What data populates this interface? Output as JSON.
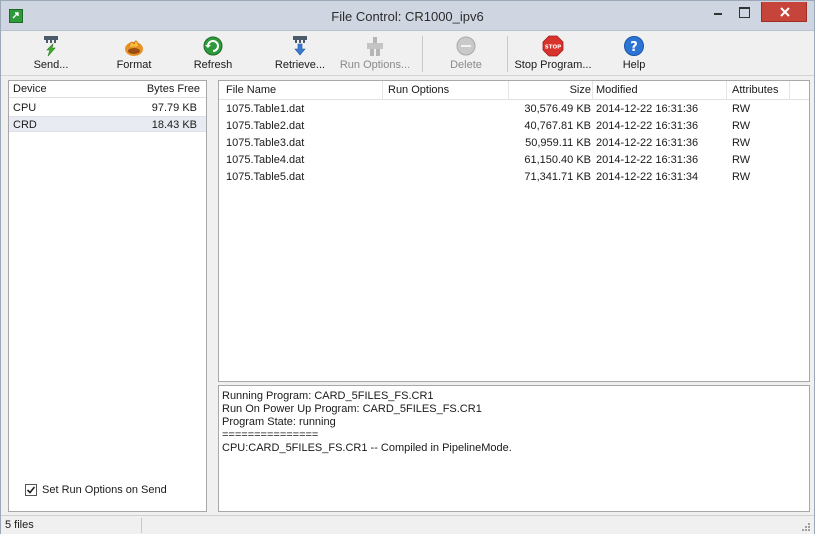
{
  "window": {
    "title": "File Control: CR1000_ipv6",
    "icon": "app-icon",
    "controls": {
      "minimize": "minimize-icon",
      "maximize": "maximize-icon",
      "close": "close-icon"
    },
    "close_color": "#c7443a"
  },
  "toolbar": {
    "buttons": [
      {
        "label": "Send...",
        "icon": "send-icon",
        "enabled": true
      },
      {
        "label": "Format",
        "icon": "format-icon",
        "enabled": true
      },
      {
        "label": "Refresh",
        "icon": "refresh-icon",
        "enabled": true
      },
      {
        "label": "Retrieve...",
        "icon": "retrieve-icon",
        "enabled": true
      },
      {
        "label": "Run Options...",
        "icon": "run-options-icon",
        "enabled": false
      },
      {
        "label": "Delete",
        "icon": "delete-icon",
        "enabled": false
      },
      {
        "label": "Stop Program...",
        "icon": "stop-icon",
        "enabled": true
      },
      {
        "label": "Help",
        "icon": "help-icon",
        "enabled": true
      }
    ]
  },
  "devices": {
    "columns": {
      "device": "Device",
      "bytes_free": "Bytes Free"
    },
    "rows": [
      {
        "device": "CPU",
        "bytes_free": "97.79 KB",
        "selected": false
      },
      {
        "device": "CRD",
        "bytes_free": "18.43 KB",
        "selected": true
      }
    ],
    "set_run_options_label": "Set Run Options on Send",
    "set_run_options_checked": true
  },
  "files": {
    "columns": {
      "name": "File Name",
      "run_options": "Run Options",
      "size": "Size",
      "modified": "Modified",
      "attributes": "Attributes"
    },
    "rows": [
      {
        "name": "1075.Table1.dat",
        "run_options": "",
        "size": "30,576.49 KB",
        "modified": "2014-12-22 16:31:36",
        "attributes": "RW"
      },
      {
        "name": "1075.Table2.dat",
        "run_options": "",
        "size": "40,767.81 KB",
        "modified": "2014-12-22 16:31:36",
        "attributes": "RW"
      },
      {
        "name": "1075.Table3.dat",
        "run_options": "",
        "size": "50,959.11 KB",
        "modified": "2014-12-22 16:31:36",
        "attributes": "RW"
      },
      {
        "name": "1075.Table4.dat",
        "run_options": "",
        "size": "61,150.40 KB",
        "modified": "2014-12-22 16:31:36",
        "attributes": "RW"
      },
      {
        "name": "1075.Table5.dat",
        "run_options": "",
        "size": "71,341.71 KB",
        "modified": "2014-12-22 16:31:34",
        "attributes": "RW"
      }
    ]
  },
  "messages": {
    "lines": [
      "Running Program: CARD_5FILES_FS.CR1",
      "Run On Power Up Program: CARD_5FILES_FS.CR1",
      "Program State: running",
      "===============",
      "CPU:CARD_5FILES_FS.CR1 -- Compiled in PipelineMode."
    ]
  },
  "status": {
    "text": "5 files"
  }
}
